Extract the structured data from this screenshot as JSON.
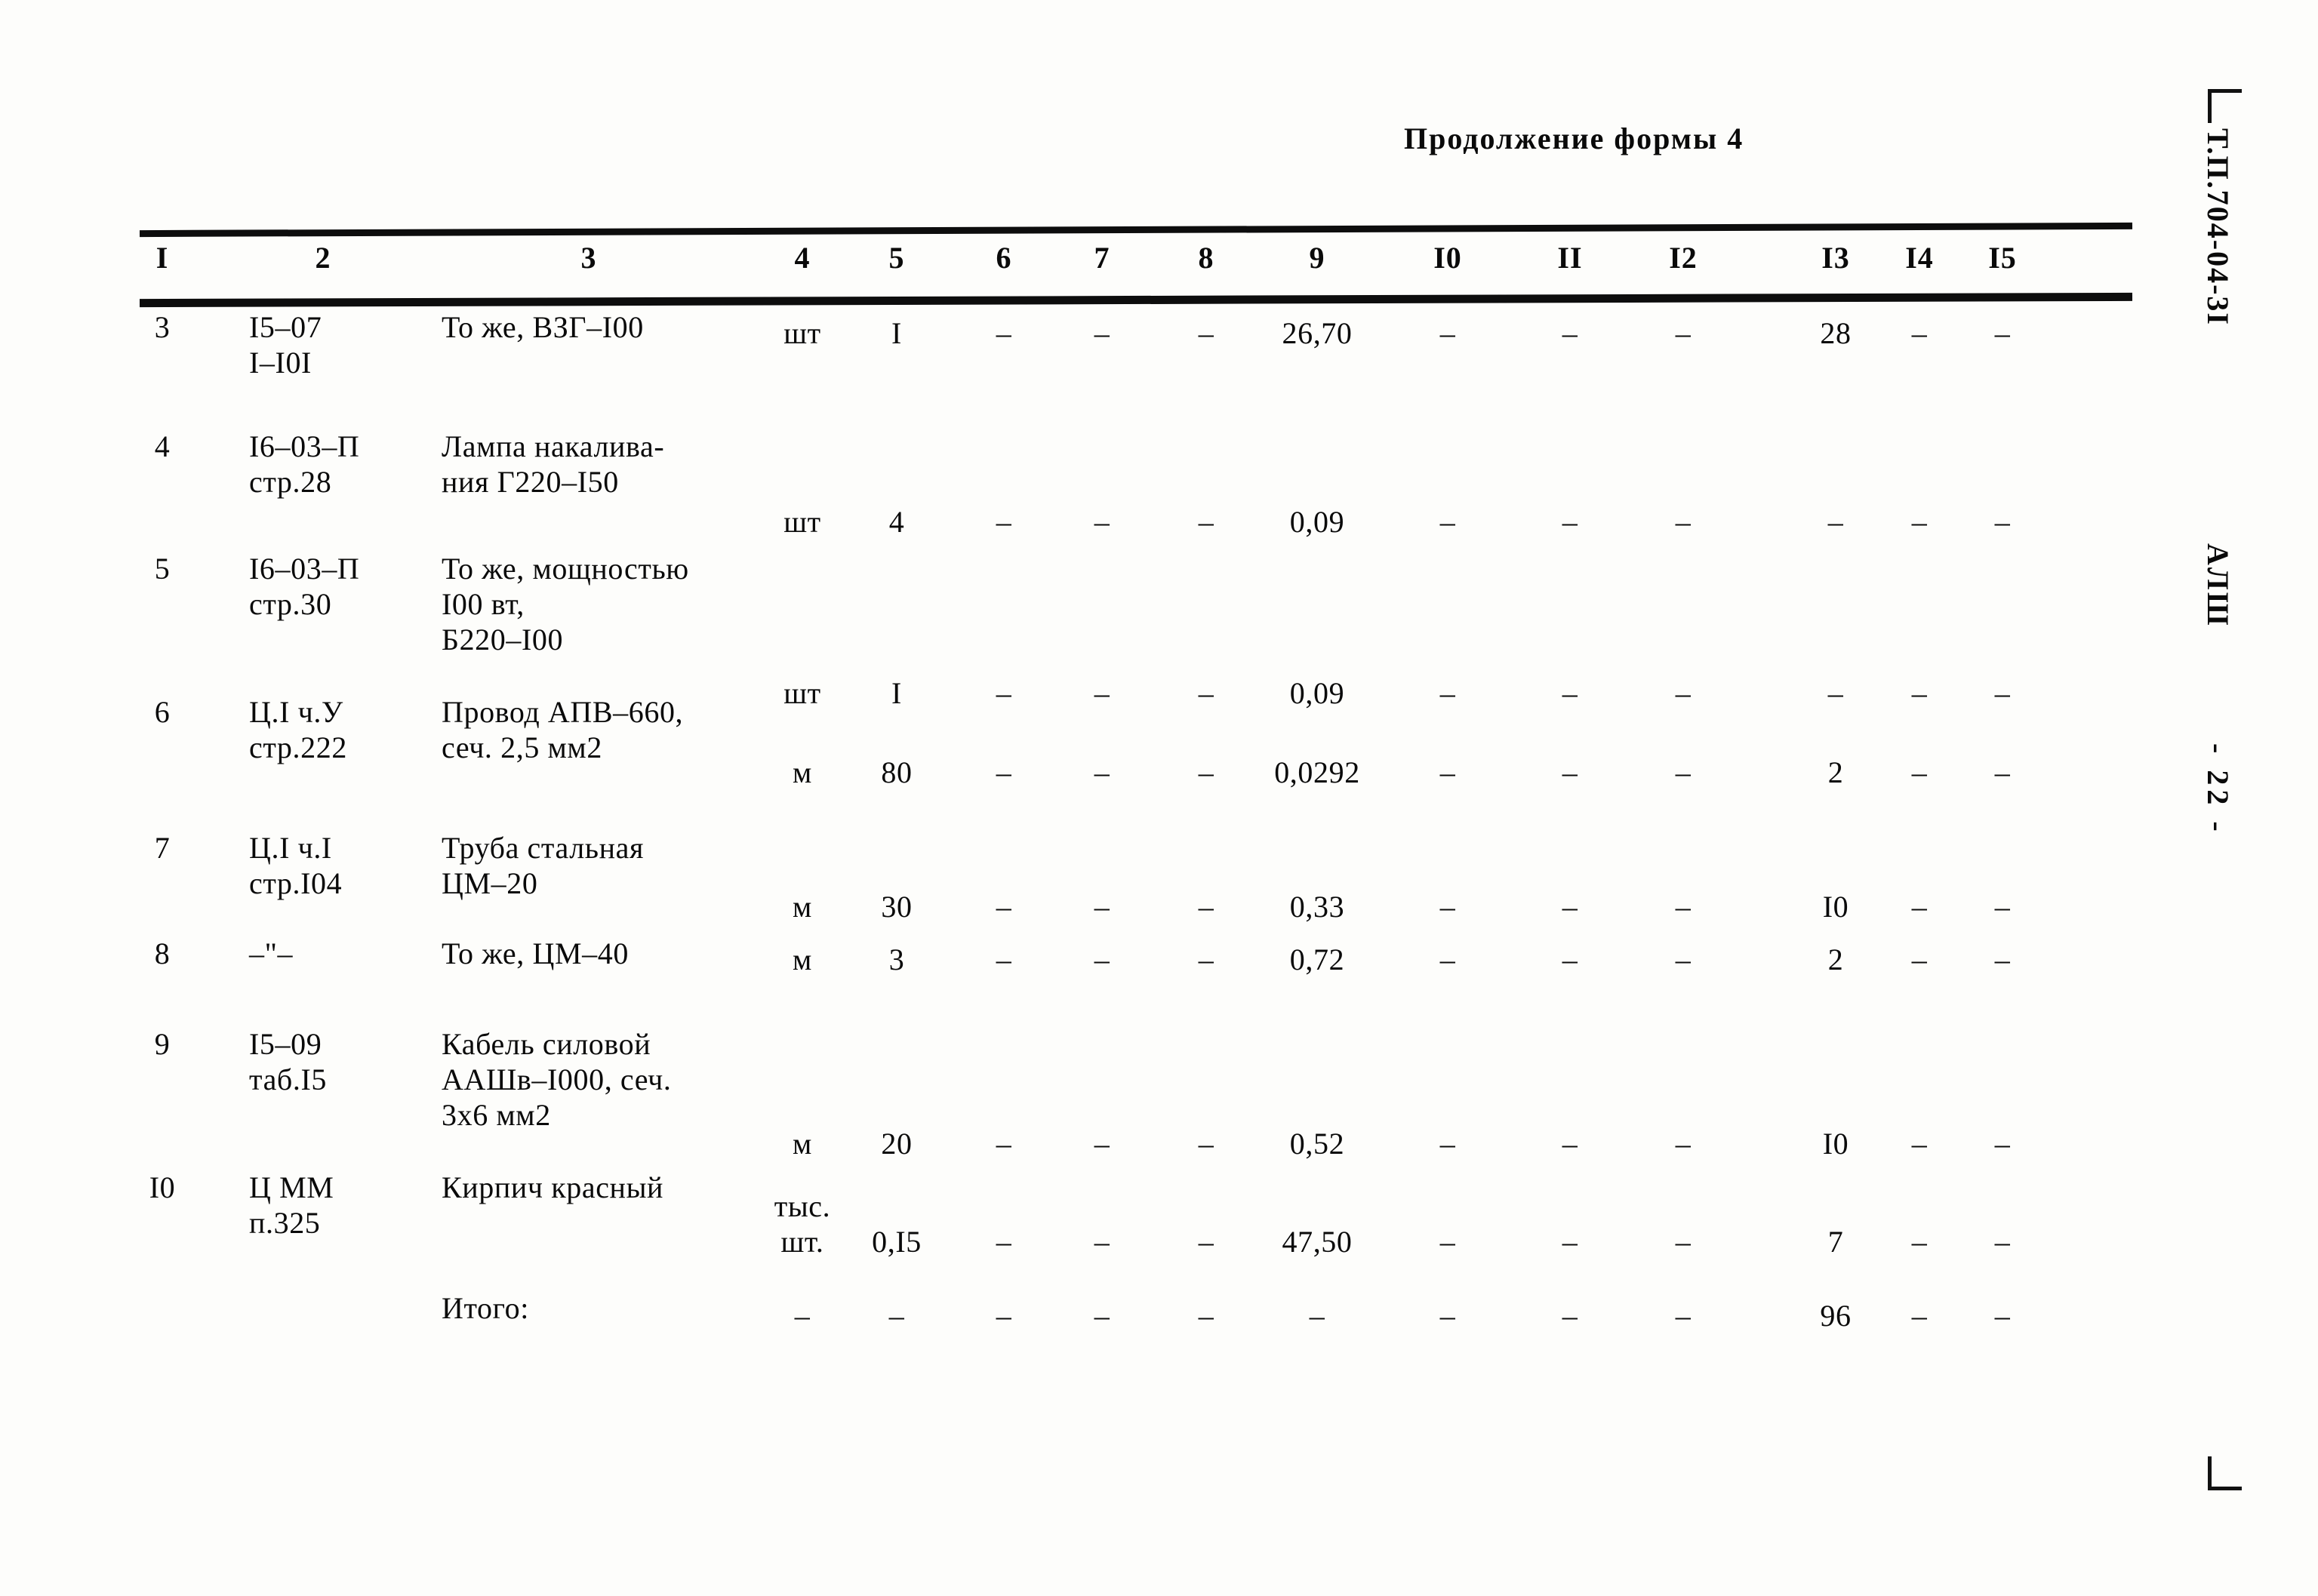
{
  "document": {
    "continuation_caption": "Продолжение формы 4",
    "margin_code": "Т.П.704-04-3I",
    "margin_series": "АЛШ",
    "margin_page": "- 22 -"
  },
  "table": {
    "column_headers": [
      "I",
      "2",
      "3",
      "4",
      "5",
      "6",
      "7",
      "8",
      "9",
      "I0",
      "II",
      "I2",
      "I3",
      "I4",
      "I5"
    ],
    "dash_glyph": "–",
    "rows": [
      {
        "no": "3",
        "ref": [
          "I5–07",
          "I–I0I"
        ],
        "name": [
          "То же, ВЗГ–I00"
        ],
        "unit": [
          "шт"
        ],
        "qty": "I",
        "c6": "–",
        "c7": "–",
        "c8": "–",
        "c9": "26,70",
        "c10": "–",
        "c11": "–",
        "c12": "–",
        "c13": "28",
        "c14": "–",
        "c15": "–"
      },
      {
        "no": "4",
        "ref": [
          "I6–03–П",
          "стр.28"
        ],
        "name": [
          "Лампа накалива-",
          "ния Г220–I50"
        ],
        "unit": [
          "шт"
        ],
        "qty": "4",
        "c6": "–",
        "c7": "–",
        "c8": "–",
        "c9": "0,09",
        "c10": "–",
        "c11": "–",
        "c12": "–",
        "c13": "–",
        "c14": "–",
        "c15": "–"
      },
      {
        "no": "5",
        "ref": [
          "I6–03–П",
          "стр.30"
        ],
        "name": [
          "То же, мощностью",
          "I00 вт,",
          "Б220–I00"
        ],
        "unit": [
          "шт"
        ],
        "qty": "I",
        "c6": "–",
        "c7": "–",
        "c8": "–",
        "c9": "0,09",
        "c10": "–",
        "c11": "–",
        "c12": "–",
        "c13": "–",
        "c14": "–",
        "c15": "–"
      },
      {
        "no": "6",
        "ref": [
          "Ц.I ч.У",
          "стр.222"
        ],
        "name": [
          "Провод АПВ–660,",
          "сеч. 2,5 мм2"
        ],
        "unit": [
          "м"
        ],
        "qty": "80",
        "c6": "–",
        "c7": "–",
        "c8": "–",
        "c9": "0,0292",
        "c10": "–",
        "c11": "–",
        "c12": "–",
        "c13": "2",
        "c14": "–",
        "c15": "–"
      },
      {
        "no": "7",
        "ref": [
          "Ц.I ч.I",
          "стр.I04"
        ],
        "name": [
          "Труба стальная",
          "ЦМ–20"
        ],
        "unit": [
          "м"
        ],
        "qty": "30",
        "c6": "–",
        "c7": "–",
        "c8": "–",
        "c9": "0,33",
        "c10": "–",
        "c11": "–",
        "c12": "–",
        "c13": "I0",
        "c14": "–",
        "c15": "–"
      },
      {
        "no": "8",
        "ref": [
          "–\"–"
        ],
        "name": [
          "То же, ЦМ–40"
        ],
        "unit": [
          "м"
        ],
        "qty": "3",
        "c6": "–",
        "c7": "–",
        "c8": "–",
        "c9": "0,72",
        "c10": "–",
        "c11": "–",
        "c12": "–",
        "c13": "2",
        "c14": "–",
        "c15": "–"
      },
      {
        "no": "9",
        "ref": [
          "I5–09",
          "таб.I5"
        ],
        "name": [
          "Кабель силовой",
          "ААШв–I000, сеч.",
          "3х6 мм2"
        ],
        "unit": [
          "м"
        ],
        "qty": "20",
        "c6": "–",
        "c7": "–",
        "c8": "–",
        "c9": "0,52",
        "c10": "–",
        "c11": "–",
        "c12": "–",
        "c13": "I0",
        "c14": "–",
        "c15": "–"
      },
      {
        "no": "I0",
        "ref": [
          "Ц ММ",
          "п.325"
        ],
        "name": [
          "Кирпич красный"
        ],
        "unit": [
          "тыс.",
          "шт."
        ],
        "qty": "0,I5",
        "c6": "–",
        "c7": "–",
        "c8": "–",
        "c9": "47,50",
        "c10": "–",
        "c11": "–",
        "c12": "–",
        "c13": "7",
        "c14": "–",
        "c15": "–"
      },
      {
        "no": "",
        "ref": [],
        "name": [
          "Итого:"
        ],
        "unit": [
          "–"
        ],
        "qty": "–",
        "c6": "–",
        "c7": "–",
        "c8": "–",
        "c9": "–",
        "c10": "–",
        "c11": "–",
        "c12": "–",
        "c13": "96",
        "c14": "–",
        "c15": "–"
      }
    ]
  }
}
